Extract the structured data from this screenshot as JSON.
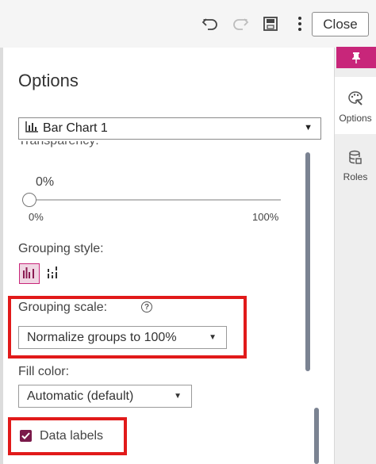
{
  "toolbar": {
    "undo_icon": "undo-icon",
    "redo_icon": "redo-icon",
    "save_icon": "save-icon",
    "more_icon": "more-icon",
    "close_label": "Close"
  },
  "rail": {
    "pin_icon": "pin-icon",
    "items": [
      {
        "label": "Options",
        "icon": "options-icon",
        "active": true
      },
      {
        "label": "Roles",
        "icon": "roles-icon",
        "active": false
      }
    ]
  },
  "panel": {
    "title": "Options",
    "object_select": {
      "value": "Bar Chart 1"
    },
    "cut_label": "Transparency:",
    "transparency": {
      "value_text": "0%",
      "value": 0,
      "min_label": "0%",
      "max_label": "100%"
    },
    "grouping_style": {
      "label": "Grouping style:",
      "options": [
        "clustered",
        "stacked"
      ],
      "selected": "clustered"
    },
    "grouping_scale": {
      "label": "Grouping scale:",
      "value": "Normalize groups to 100%"
    },
    "fill_color": {
      "label": "Fill color:",
      "value": "Automatic (default)"
    },
    "data_labels": {
      "label": "Data labels",
      "checked": true
    }
  },
  "colors": {
    "accent": "#c8267a",
    "checkbox": "#7a1a4a",
    "highlight": "#e11a1a",
    "scrollbar": "#7b8392"
  }
}
